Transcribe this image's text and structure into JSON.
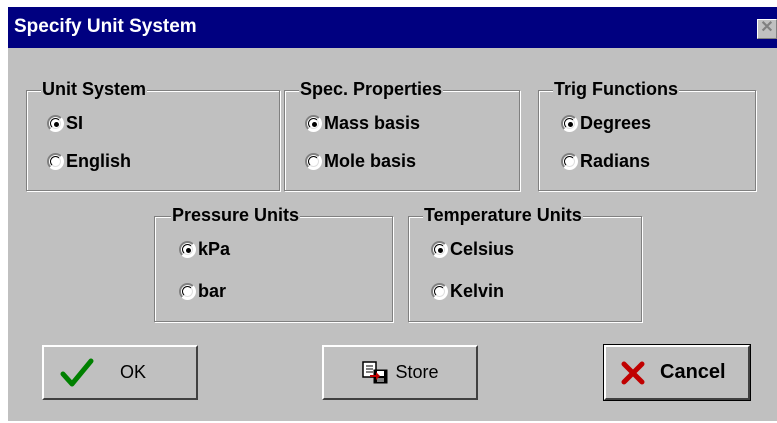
{
  "window": {
    "title": "Specify Unit System",
    "close_glyph": "✕"
  },
  "groups": {
    "unit_system": {
      "label": "Unit System",
      "options": [
        "SI",
        "English"
      ],
      "selected": "SI"
    },
    "spec_properties": {
      "label": "Spec. Properties",
      "options": [
        "Mass basis",
        "Mole basis"
      ],
      "selected": "Mass basis"
    },
    "trig_functions": {
      "label": "Trig Functions",
      "options": [
        "Degrees",
        "Radians"
      ],
      "selected": "Degrees"
    },
    "pressure_units": {
      "label": "Pressure Units",
      "options": [
        "kPa",
        "bar"
      ],
      "selected": "kPa"
    },
    "temperature_units": {
      "label": "Temperature Units",
      "options": [
        "Celsius",
        "Kelvin"
      ],
      "selected": "Celsius"
    }
  },
  "buttons": {
    "ok": {
      "label": "OK",
      "icon": "checkmark-icon",
      "icon_color": "#008000"
    },
    "store": {
      "label": "Store",
      "icon": "store-icon"
    },
    "cancel": {
      "label": "Cancel",
      "icon": "x-icon",
      "icon_color": "#c00000"
    }
  }
}
